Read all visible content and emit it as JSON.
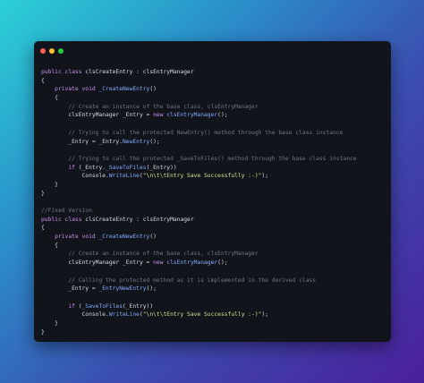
{
  "window": {
    "buttons": {
      "close_color": "#ff5f56",
      "minimize_color": "#ffbd2e",
      "maximize_color": "#27c93f"
    }
  },
  "code_lines": [
    [
      [
        "kw",
        "public class "
      ],
      [
        "pl",
        "clsCreateEntry : clsEntryManager"
      ]
    ],
    [
      [
        "pl",
        "{"
      ]
    ],
    [
      [
        "pl",
        "    "
      ],
      [
        "kw",
        "private void "
      ],
      [
        "fn",
        "_CreateNewEntry"
      ],
      [
        "pl",
        "()"
      ]
    ],
    [
      [
        "pl",
        "    {"
      ]
    ],
    [
      [
        "pl",
        "        "
      ],
      [
        "cm",
        "// Create an instance of the base class, clsEntryManager"
      ]
    ],
    [
      [
        "pl",
        "        clsEntryManager _Entry = "
      ],
      [
        "kw",
        "new "
      ],
      [
        "fn",
        "clsEntryManager"
      ],
      [
        "pl",
        "();"
      ]
    ],
    [
      [
        "pl",
        ""
      ]
    ],
    [
      [
        "pl",
        "        "
      ],
      [
        "cm",
        "// Trying to call the protected NewEntry() method through the base class instance"
      ]
    ],
    [
      [
        "pl",
        "        _Entry = _Entry."
      ],
      [
        "fn",
        "NewEntry"
      ],
      [
        "pl",
        "();"
      ]
    ],
    [
      [
        "pl",
        ""
      ]
    ],
    [
      [
        "pl",
        "        "
      ],
      [
        "cm",
        "// Trying to call the protected _SaveToFiles() method through the base class instance"
      ]
    ],
    [
      [
        "pl",
        "        "
      ],
      [
        "kw",
        "if "
      ],
      [
        "pl",
        "(_Entry."
      ],
      [
        "fn",
        "_SaveToFiles"
      ],
      [
        "pl",
        "(_Entry))"
      ]
    ],
    [
      [
        "pl",
        "            Console."
      ],
      [
        "fn",
        "WriteLine"
      ],
      [
        "pl",
        "("
      ],
      [
        "str",
        "\"\\n\\t\\tEntry Save Successfully :-)\""
      ],
      [
        "pl",
        ");"
      ]
    ],
    [
      [
        "pl",
        "    }"
      ]
    ],
    [
      [
        "pl",
        "}"
      ]
    ],
    [
      [
        "pl",
        ""
      ]
    ],
    [
      [
        "cm",
        "//Fixed Version"
      ]
    ],
    [
      [
        "kw",
        "public class "
      ],
      [
        "pl",
        "clsCreateEntry : clsEntryManager"
      ]
    ],
    [
      [
        "pl",
        "{"
      ]
    ],
    [
      [
        "pl",
        "    "
      ],
      [
        "kw",
        "private void "
      ],
      [
        "fn",
        "_CreateNewEntry"
      ],
      [
        "pl",
        "()"
      ]
    ],
    [
      [
        "pl",
        "    {"
      ]
    ],
    [
      [
        "pl",
        "        "
      ],
      [
        "cm",
        "// Create an instance of the base class, clsEntryManager"
      ]
    ],
    [
      [
        "pl",
        "        clsEntryManager _Entry = "
      ],
      [
        "kw",
        "new "
      ],
      [
        "fn",
        "clsEntryManager"
      ],
      [
        "pl",
        "();"
      ]
    ],
    [
      [
        "pl",
        ""
      ]
    ],
    [
      [
        "pl",
        "        "
      ],
      [
        "cm",
        "// Calling the protected method as it is implemented in the derived class"
      ]
    ],
    [
      [
        "pl",
        "        _Entry = "
      ],
      [
        "fn",
        "_EntryNewEntry"
      ],
      [
        "pl",
        "();"
      ]
    ],
    [
      [
        "pl",
        ""
      ]
    ],
    [
      [
        "pl",
        "        "
      ],
      [
        "kw",
        "if "
      ],
      [
        "pl",
        "("
      ],
      [
        "fn",
        "_SaveToFiles"
      ],
      [
        "pl",
        "(_Entry))"
      ]
    ],
    [
      [
        "pl",
        "            Console."
      ],
      [
        "fn",
        "WriteLine"
      ],
      [
        "pl",
        "("
      ],
      [
        "str",
        "\"\\n\\t\\tEntry Save Successfully :-)\""
      ],
      [
        "pl",
        ");"
      ]
    ],
    [
      [
        "pl",
        "    }"
      ]
    ],
    [
      [
        "pl",
        "}"
      ]
    ]
  ]
}
